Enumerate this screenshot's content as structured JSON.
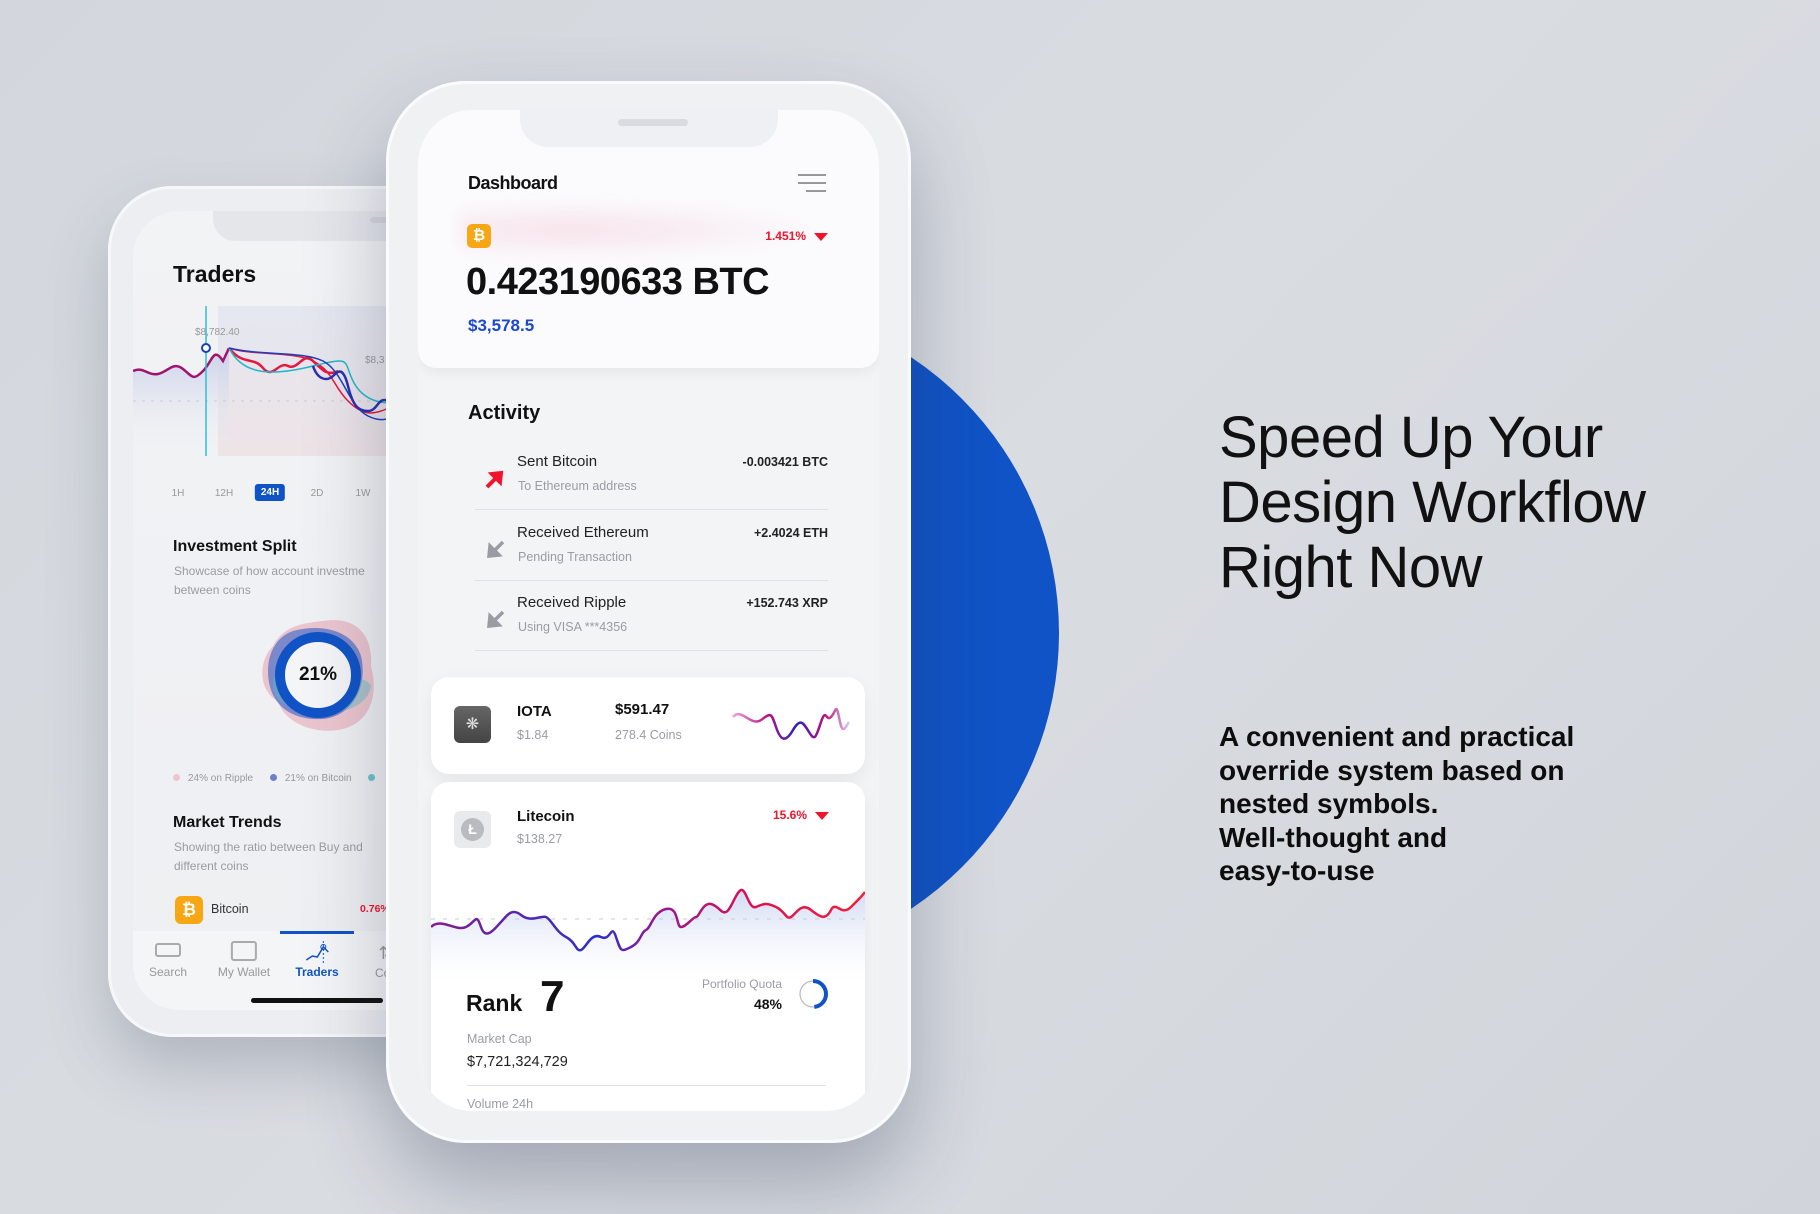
{
  "colors": {
    "accent_blue": "#1053c6",
    "negative_red": "#f0142c",
    "bitcoin_orange": "#f7a614"
  },
  "traders_screen": {
    "title": "Traders",
    "chart": {
      "peak_label": "$8,782.40",
      "right_label": "$8,3"
    },
    "time_tabs": [
      "1H",
      "12H",
      "24H",
      "2D",
      "1W"
    ],
    "active_tab": "24H",
    "investment_split": {
      "title": "Investment Split",
      "description_line1": "Showcase of how account investme",
      "description_line2": "between coins",
      "center_value": "21%",
      "legend": [
        {
          "label": "24% on Ripple",
          "color": "#f0c4cc"
        },
        {
          "label": "21% on Bitcoin",
          "color": "#6d80c8"
        },
        {
          "label": "",
          "color": "#6cc3cc"
        }
      ]
    },
    "market_trends": {
      "title": "Market Trends",
      "description_line1": "Showing the ratio between Buy and",
      "description_line2": "different coins",
      "row": {
        "coin": "Bitcoin",
        "change": "0.76%"
      }
    },
    "bottom_nav": [
      {
        "label": "Search",
        "icon": "search-card-icon"
      },
      {
        "label": "My Wallet",
        "icon": "wallet-icon"
      },
      {
        "label": "Traders",
        "icon": "chart-icon",
        "active": true
      },
      {
        "label": "Con",
        "icon": "convert-icon"
      }
    ]
  },
  "dashboard_screen": {
    "title": "Dashboard",
    "balance": {
      "change": "1.451%",
      "amount": "0.423190633 BTC",
      "fiat": "$3,578.5"
    },
    "activity": {
      "title": "Activity",
      "items": [
        {
          "title": "Sent Bitcoin",
          "subtitle": "To Ethereum address",
          "amount": "-0.003421 BTC",
          "direction": "sent"
        },
        {
          "title": "Received Ethereum",
          "subtitle": "Pending Transaction",
          "amount": "+2.4024 ETH",
          "direction": "received"
        },
        {
          "title": "Received Ripple",
          "subtitle": "Using VISA ***4356",
          "amount": "+152.743 XRP",
          "direction": "received"
        }
      ]
    },
    "iota": {
      "name": "IOTA",
      "price": "$1.84",
      "value": "$591.47",
      "coins": "278.4 Coins"
    },
    "litecoin": {
      "name": "Litecoin",
      "price": "$138.27",
      "change": "15.6%",
      "rank_label": "Rank",
      "rank": "7",
      "portfolio_label": "Portfolio Quota",
      "portfolio_value": "48%",
      "portfolio_fraction": 0.48,
      "market_cap_label": "Market Cap",
      "market_cap": "$7,721,324,729",
      "volume_label": "Volume 24h"
    }
  },
  "marketing": {
    "headline": [
      "Speed Up Your",
      "Design Workflow",
      "Right Now"
    ],
    "paragraph": [
      "A convenient and practical",
      "override system based on",
      "nested symbols.",
      "Well-thought and",
      "easy-to-use"
    ]
  }
}
